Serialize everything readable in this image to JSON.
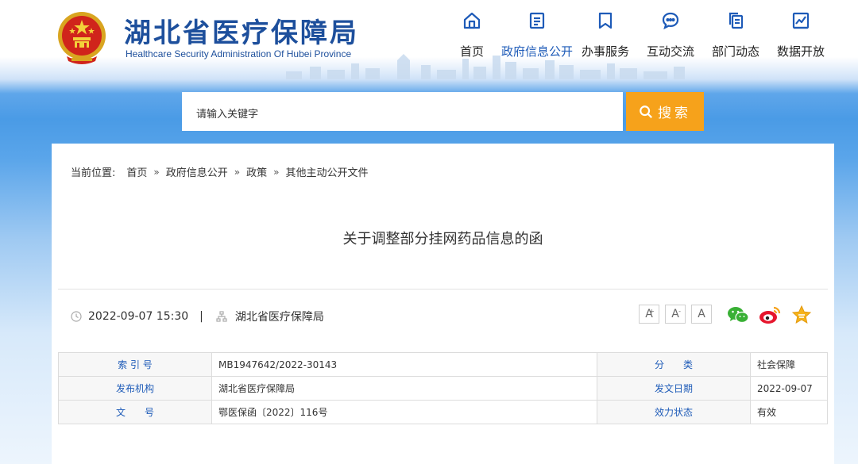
{
  "site": {
    "title_cn": "湖北省医疗保障局",
    "title_en": "Healthcare Security Administration Of Hubei Province"
  },
  "nav": {
    "items": [
      {
        "label": "首页",
        "icon": "home-icon"
      },
      {
        "label": "政府信息公开",
        "icon": "document-list-icon"
      },
      {
        "label": "办事服务",
        "icon": "bookmark-icon"
      },
      {
        "label": "互动交流",
        "icon": "chat-bubble-icon"
      },
      {
        "label": "部门动态",
        "icon": "copy-files-icon"
      },
      {
        "label": "数据开放",
        "icon": "chart-trend-icon"
      }
    ],
    "active_label": "政府信息公开"
  },
  "search": {
    "placeholder": "请输入关键字",
    "button_label": "搜索"
  },
  "breadcrumb": {
    "prefix": "当前位置:",
    "items": [
      "首页",
      "政府信息公开",
      "政策",
      "其他主动公开文件"
    ]
  },
  "article": {
    "title": "关于调整部分挂网药品信息的函",
    "datetime": "2022-09-07 15:30",
    "publisher": "湖北省医疗保障局"
  },
  "font_buttons": {
    "large": "A",
    "medium": "A",
    "small": "A"
  },
  "share": [
    "wechat-icon",
    "weibo-icon",
    "favorite-star-icon"
  ],
  "info_table": {
    "rows": [
      {
        "k1": "索 引 号",
        "v1": "MB1947642/2022-30143",
        "k2": "分　　类",
        "v2": "社会保障"
      },
      {
        "k1": "发布机构",
        "v1": "湖北省医疗保障局",
        "k2": "发文日期",
        "v2": "2022-09-07"
      },
      {
        "k1": "文　　号",
        "v1": "鄂医保函〔2022〕116号",
        "k2": "效力状态",
        "v2": "有效"
      }
    ]
  },
  "colors": {
    "brand_blue": "#1d4f9c",
    "link_blue": "#1e5bb8",
    "search_orange": "#f6a21b"
  }
}
